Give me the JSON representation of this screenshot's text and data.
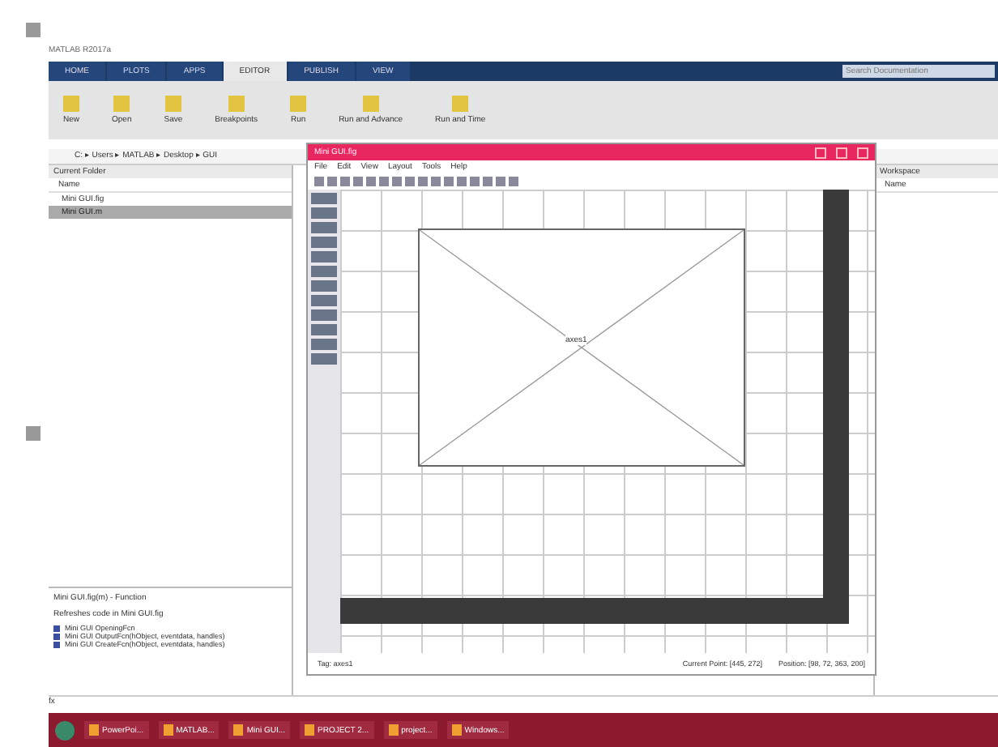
{
  "matlab": {
    "title": "MATLAB R2017a",
    "tabs": [
      {
        "label": "HOME",
        "selected": false
      },
      {
        "label": "PLOTS",
        "selected": false
      },
      {
        "label": "APPS",
        "selected": false
      },
      {
        "label": "EDITOR",
        "selected": true
      },
      {
        "label": "PUBLISH",
        "selected": false
      },
      {
        "label": "VIEW",
        "selected": false
      }
    ],
    "search_placeholder": "Search Documentation",
    "ribbon_buttons": [
      "New",
      "Open",
      "Save",
      "Breakpoints",
      "Run",
      "Run and Advance",
      "Run and Time"
    ],
    "path": "C: ▸ Users ▸ MATLAB ▸ Desktop ▸ GUI",
    "current_folder": {
      "title": "Current Folder",
      "header": "Name",
      "items": [
        {
          "label": "Mini GUI.fig",
          "selected": false
        },
        {
          "label": "Mini GUI.m",
          "selected": true
        }
      ]
    },
    "details": {
      "title": "Mini GUI.fig(m) - Function",
      "text": "Refreshes code in Mini GUI.fig",
      "items": [
        "Mini GUI OpeningFcn",
        "Mini GUI OutputFcn(hObject, eventdata, handles)",
        "Mini GUI CreateFcn(hObject, eventdata, handles)"
      ]
    },
    "workspace": {
      "title": "Workspace",
      "header": "Name"
    },
    "status": "fx"
  },
  "guide": {
    "title": "Mini GUI.fig",
    "menu": [
      "File",
      "Edit",
      "View",
      "Layout",
      "Tools",
      "Help"
    ],
    "axes_label": "axes1",
    "status": {
      "tag": "Tag: axes1",
      "current_point": "Current Point: [445, 272]",
      "position": "Position: [98, 72, 363, 200]"
    }
  },
  "taskbar": {
    "apps": [
      "PowerPoi...",
      "MATLAB...",
      "Mini GUI...",
      "PROJECT 2...",
      "project...",
      "Windows..."
    ]
  }
}
